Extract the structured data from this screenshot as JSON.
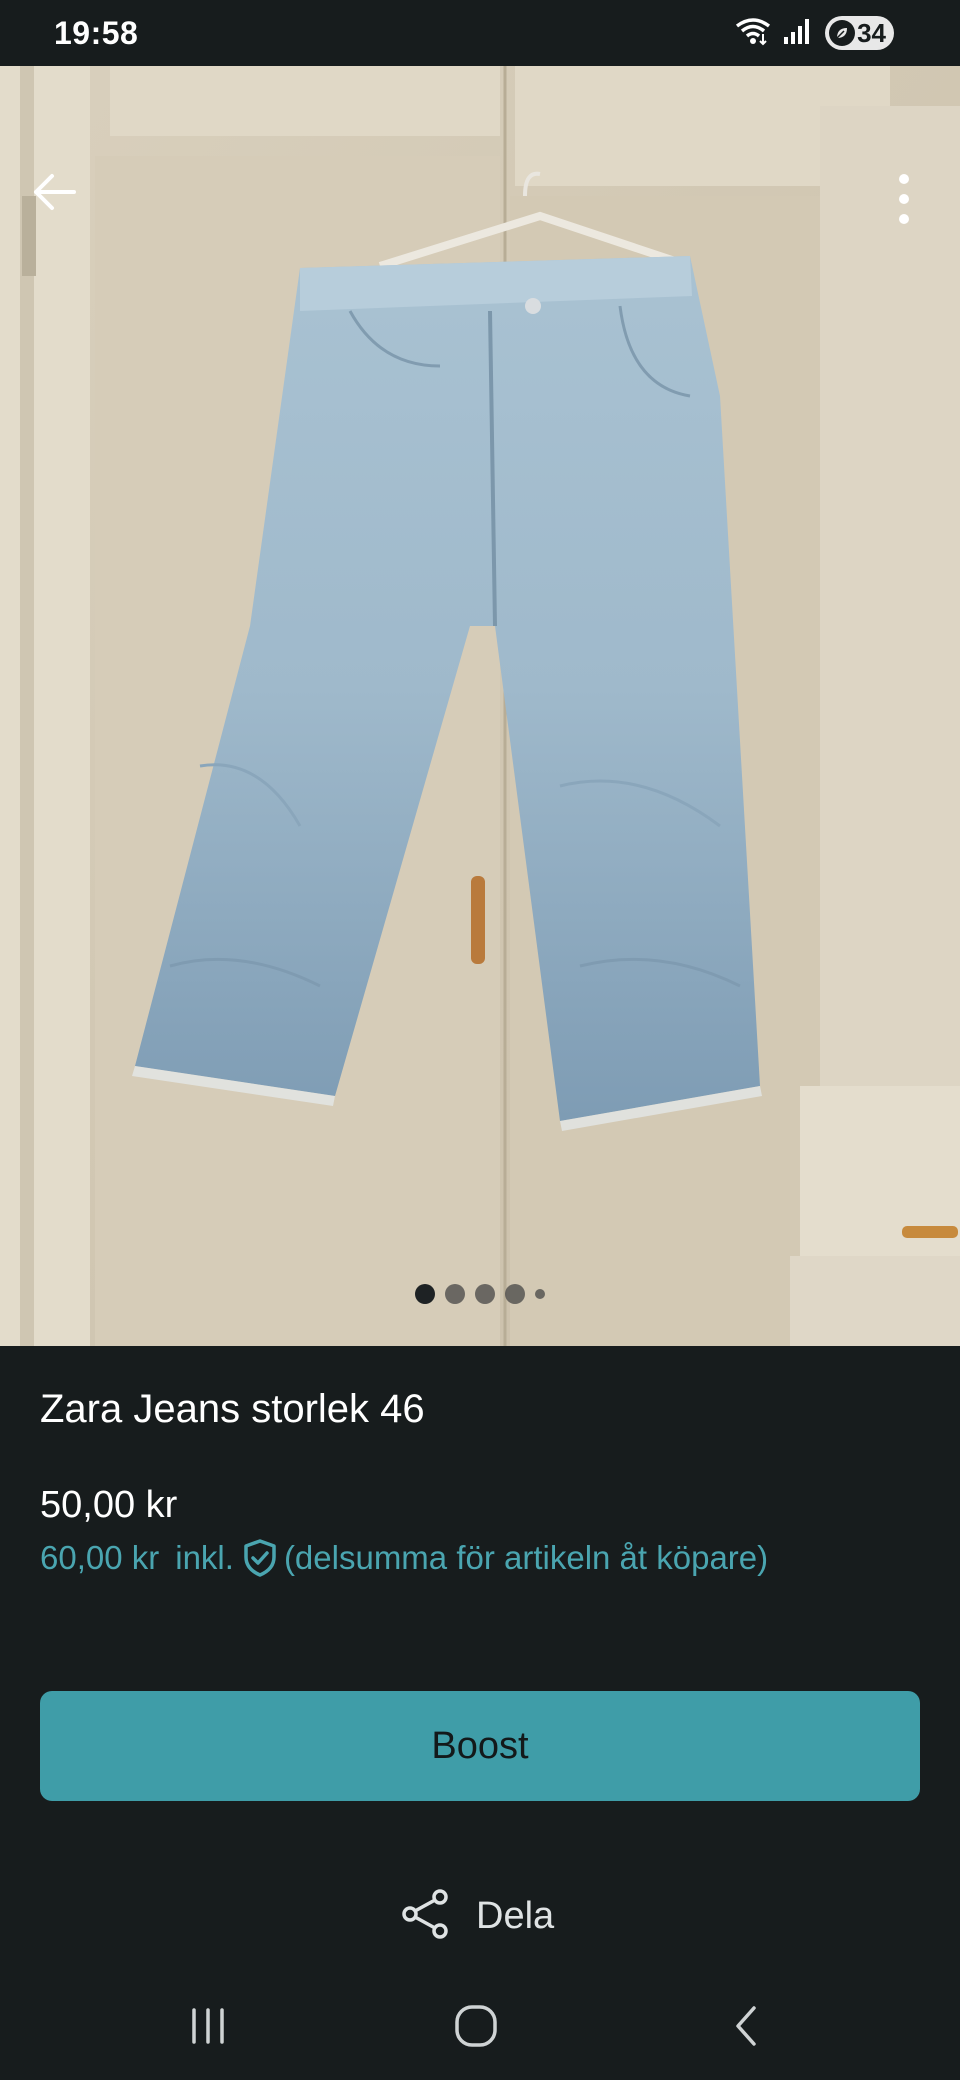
{
  "status_bar": {
    "time": "19:58",
    "battery": "34"
  },
  "photo": {
    "page_count": 5,
    "active_page": 1
  },
  "listing": {
    "title": "Zara Jeans storlek 46",
    "price": "50,00 kr",
    "price_incl_amount": "60,00 kr",
    "price_incl_label": "inkl.",
    "price_incl_note": "(delsumma för artikeln åt köpare)"
  },
  "actions": {
    "boost_label": "Boost",
    "share_label": "Dela"
  },
  "colors": {
    "background": "#171c1d",
    "accent": "#3f9da8",
    "accent_text": "#4aa5b0"
  },
  "icons": {
    "back": "arrow-left-icon",
    "more": "more-vertical-icon",
    "shield": "shield-check-icon",
    "share": "share-icon",
    "nav_recents": "recents-icon",
    "nav_home": "home-icon",
    "nav_back": "nav-back-icon"
  }
}
